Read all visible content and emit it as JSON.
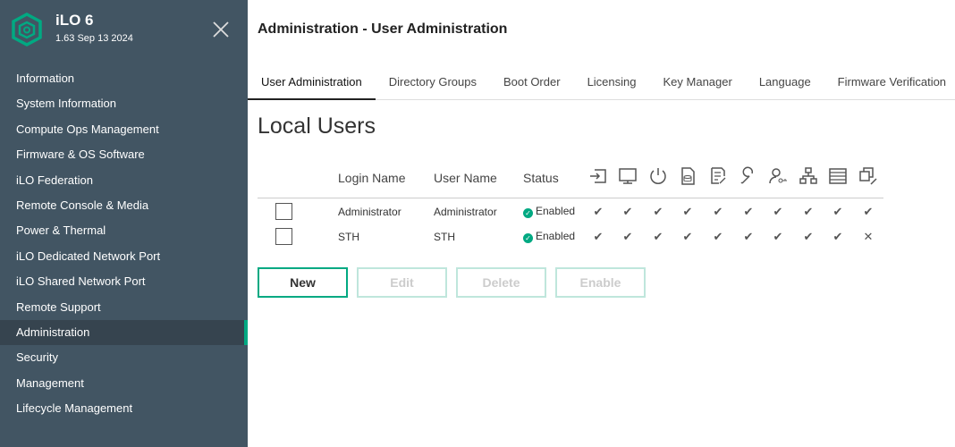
{
  "sidebar": {
    "title": "iLO 6",
    "version": "1.63 Sep 13 2024",
    "items": [
      "Information",
      "System Information",
      "Compute Ops Management",
      "Firmware & OS Software",
      "iLO Federation",
      "Remote Console & Media",
      "Power & Thermal",
      "iLO Dedicated Network Port",
      "iLO Shared Network Port",
      "Remote Support",
      "Administration",
      "Security",
      "Management",
      "Lifecycle Management"
    ],
    "active": "Administration"
  },
  "header": {
    "title": "Administration - User Administration"
  },
  "tabs": [
    "User Administration",
    "Directory Groups",
    "Boot Order",
    "Licensing",
    "Key Manager",
    "Language",
    "Firmware Verification"
  ],
  "section_title": "Local Users",
  "table": {
    "headers": [
      "Login Name",
      "User Name",
      "Status"
    ],
    "privilege_icons": [
      "login-icon",
      "remote-console-icon",
      "power-icon",
      "virtual-media-icon",
      "config-settings-icon",
      "host-bios-icon",
      "user-accounts-icon",
      "host-nic-icon",
      "host-storage-icon",
      "recovery-set-icon"
    ],
    "rows": [
      {
        "login": "Administrator",
        "user": "Administrator",
        "status": "Enabled",
        "privs": [
          true,
          true,
          true,
          true,
          true,
          true,
          true,
          true,
          true,
          true
        ]
      },
      {
        "login": "STH",
        "user": "STH",
        "status": "Enabled",
        "privs": [
          true,
          true,
          true,
          true,
          true,
          true,
          true,
          true,
          true,
          false
        ]
      }
    ]
  },
  "buttons": {
    "new": "New",
    "edit": "Edit",
    "delete": "Delete",
    "enable": "Enable"
  },
  "colors": {
    "accent": "#01a982",
    "sidebar": "#425563"
  }
}
